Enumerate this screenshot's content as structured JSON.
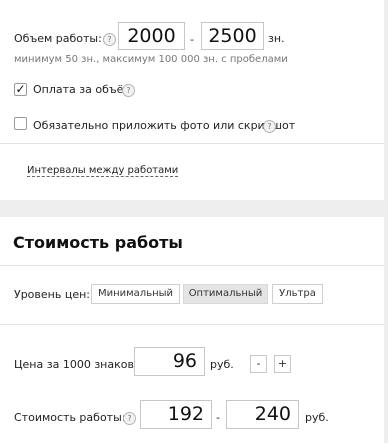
{
  "volume": {
    "label": "Объем работы:",
    "from": "2000",
    "dash": "-",
    "to": "2500",
    "unit": "зн.",
    "hint": "минимум 50 зн., максимум 100 000 зн. с пробелами"
  },
  "options": {
    "pay_per_volume": {
      "label": "Оплата за объём",
      "checked": true
    },
    "attach_photo": {
      "label": "Обязательно приложить фото или скриншот",
      "checked": false
    }
  },
  "intervals_link": "Интервалы между работами",
  "cost": {
    "title": "Стоимость работы",
    "price_level_label": "Уровень цен:",
    "price_levels": [
      "Минимальный",
      "Оптимальный",
      "Ультра"
    ],
    "selected_level": "Оптимальный",
    "per_1000_label": "Цена за 1000 знаков:",
    "per_1000_value": "96",
    "currency": "руб.",
    "minus": "-",
    "plus": "+",
    "total_label": "Стоимость работы:",
    "total_from": "192",
    "total_dash": "-",
    "total_to": "240"
  },
  "help_icon_glyph": "?",
  "check_glyph": "✓"
}
